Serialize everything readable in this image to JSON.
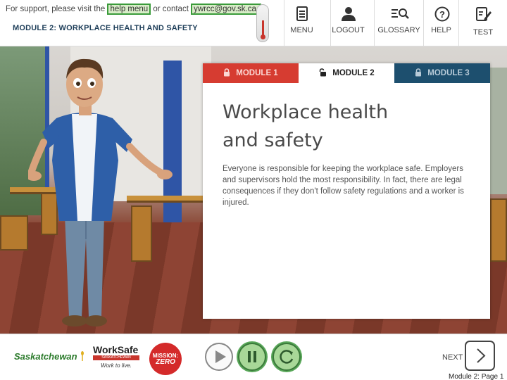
{
  "header": {
    "support_prefix": "For support, please visit the",
    "help_link": "help menu",
    "support_middle": "or contact",
    "contact_email": "ywrcc@gov.sk.ca.",
    "module_title": "MODULE 2: WORKPLACE HEALTH AND SAFETY",
    "nav": [
      {
        "label": "MENU",
        "icon": "menu-document-icon"
      },
      {
        "label": "LOGOUT",
        "icon": "user-logout-icon"
      },
      {
        "label": "GLOSSARY",
        "icon": "glossary-search-icon"
      },
      {
        "label": "HELP",
        "icon": "help-question-icon"
      },
      {
        "label": "TEST",
        "icon": "test-edit-icon"
      }
    ]
  },
  "card": {
    "tabs": [
      {
        "label": "MODULE 1",
        "state": "locked",
        "color": "#d63c31"
      },
      {
        "label": "MODULE 2",
        "state": "active",
        "color": "#ffffff"
      },
      {
        "label": "MODULE 3",
        "state": "locked",
        "color": "#1d4f6e"
      }
    ],
    "heading_line1": "Workplace health",
    "heading_line2": "and safety",
    "body": "Everyone is responsible for keeping the workplace safe. Employers and supervisors hold the most responsibility. In fact, there are legal consequences if they don't follow safety regulations and a worker is injured."
  },
  "footer": {
    "saskatchewan_logo": "Saskatchewan",
    "worksafe_name": "WorkSafe",
    "worksafe_sub": "SASKATCHEWAN",
    "worksafe_tag": "Work to live.",
    "mission_line1": "MISSION:",
    "mission_line2": "ZERO",
    "next_label": "NEXT",
    "page_indicator": "Module 2: Page 1"
  },
  "colors": {
    "accent_green": "#3a9b3a",
    "module1_red": "#d63c31",
    "module3_navy": "#1d4f6e"
  }
}
